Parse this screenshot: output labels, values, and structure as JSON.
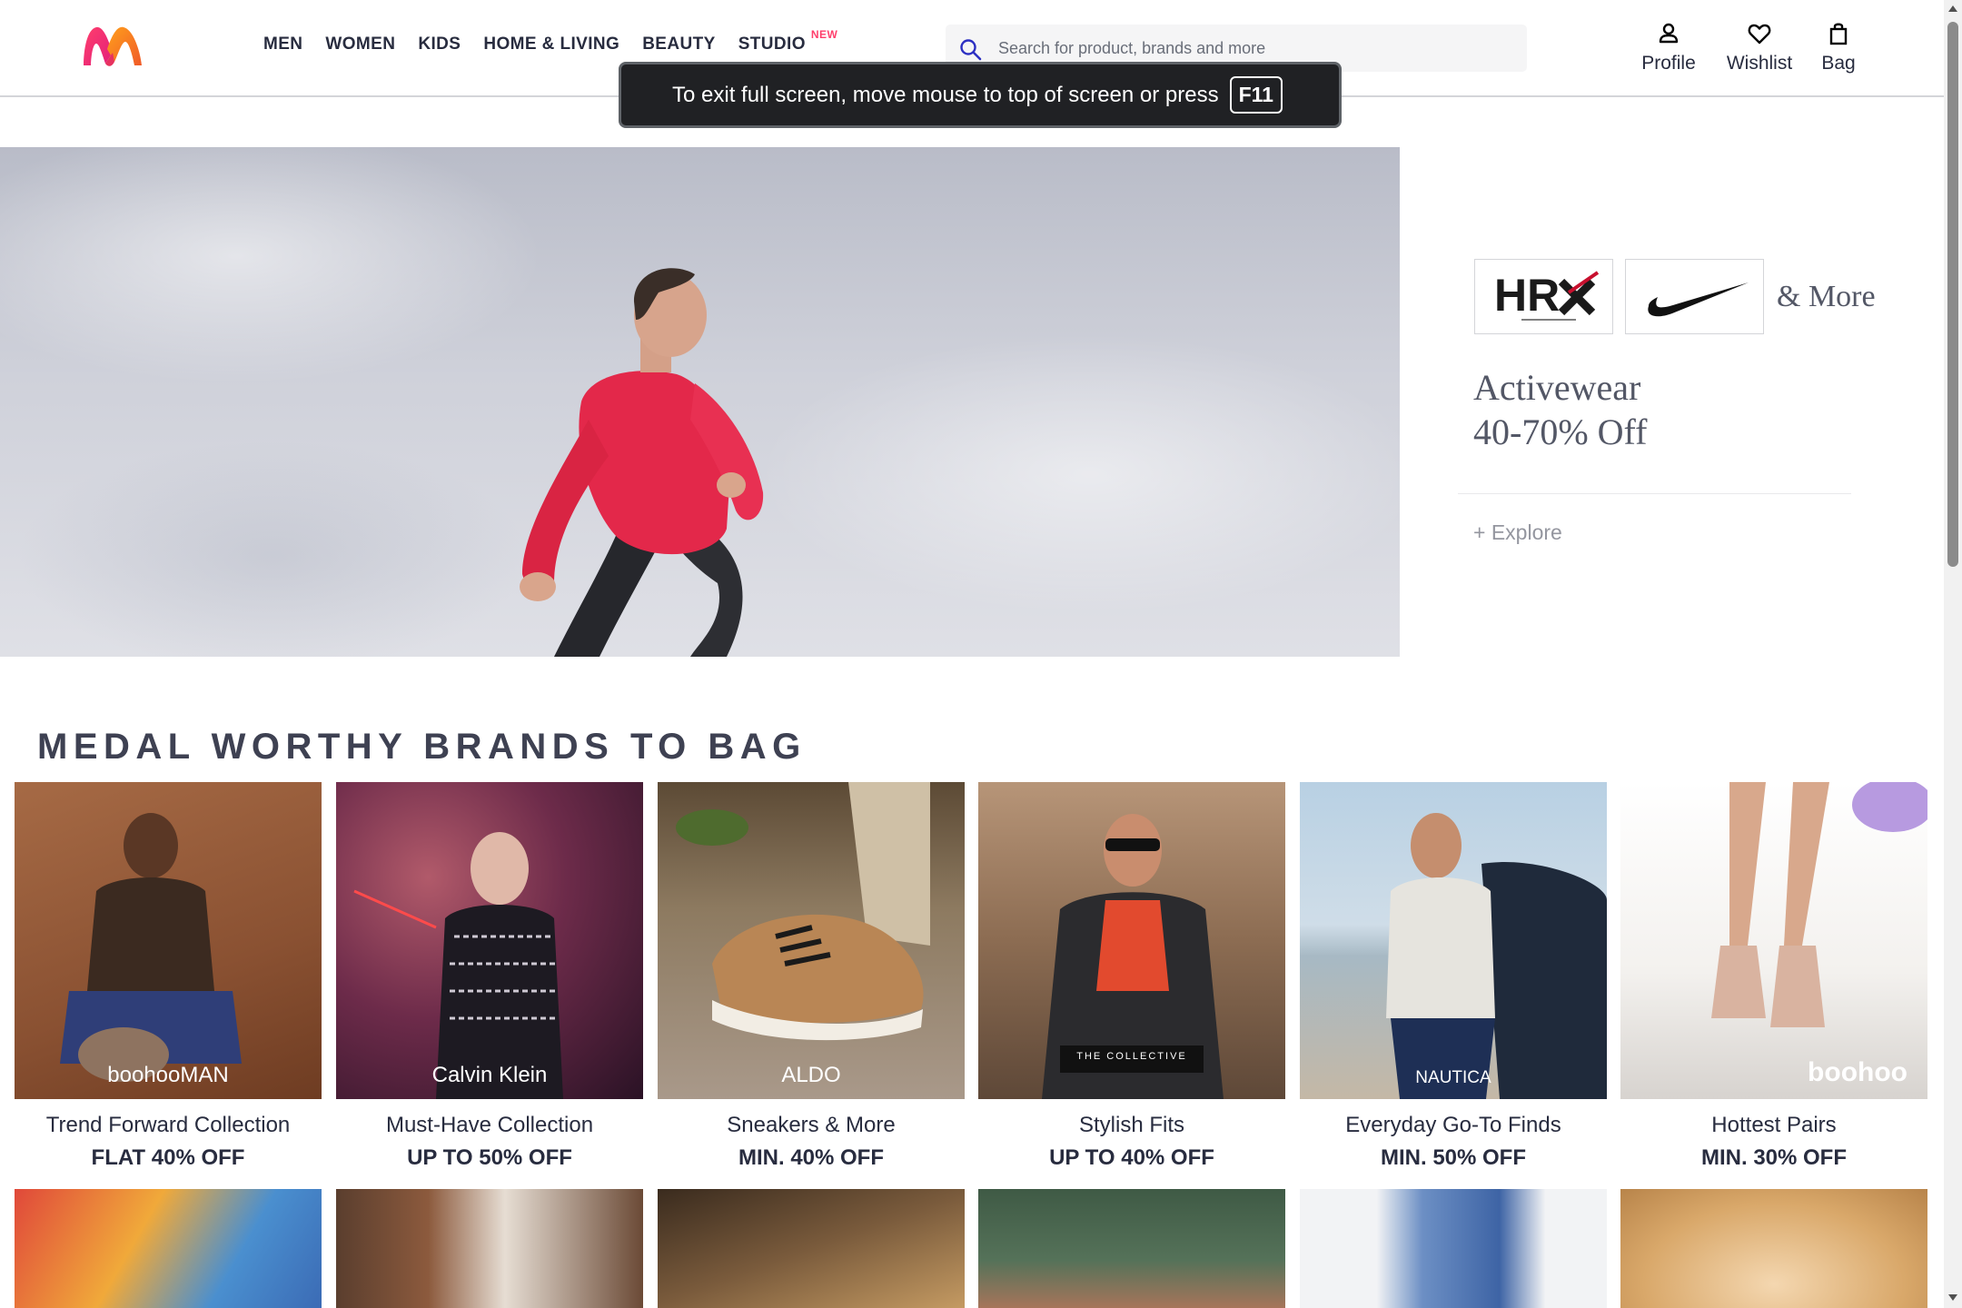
{
  "header": {
    "logo": "myntra-logo",
    "nav": [
      {
        "label": "Men"
      },
      {
        "label": "Women"
      },
      {
        "label": "Kids"
      },
      {
        "label": "Home & Living"
      },
      {
        "label": "Beauty"
      },
      {
        "label": "Studio",
        "badge": "NEW"
      }
    ],
    "search": {
      "placeholder": "Search for product, brands and more",
      "value": "",
      "icon": "search-icon"
    },
    "actions": [
      {
        "label": "Profile",
        "icon": "profile-icon"
      },
      {
        "label": "Wishlist",
        "icon": "heart-icon"
      },
      {
        "label": "Bag",
        "icon": "bag-icon"
      }
    ]
  },
  "fullscreen_toast": {
    "text": "To exit full screen, move mouse to top of screen or press",
    "key": "F11"
  },
  "hero": {
    "brands": [
      "HRX",
      "Nike"
    ],
    "more": "& More",
    "title_line1": "Activewear",
    "title_line2": "40-70% Off",
    "cta": "+ Explore"
  },
  "section": {
    "title": "Medal Worthy Brands To Bag",
    "cards": [
      {
        "brand": "boohooMAN",
        "title": "Trend Forward Collection",
        "offer": "FLAT 40% OFF"
      },
      {
        "brand": "Calvin Klein",
        "title": "Must-Have Collection",
        "offer": "UP TO 50% OFF"
      },
      {
        "brand": "ALDO",
        "title": "Sneakers & More",
        "offer": "MIN. 40% OFF"
      },
      {
        "brand": "THE COLLECTIVE",
        "title": "Stylish Fits",
        "offer": "UP TO 40% OFF"
      },
      {
        "brand": "NAUTICA",
        "title": "Everyday Go-To Finds",
        "offer": "MIN. 50% OFF"
      },
      {
        "brand": "boohoo",
        "title": "Hottest Pairs",
        "offer": "MIN. 30% OFF"
      }
    ]
  },
  "colors": {
    "accent": "#ff3f6c",
    "text": "#282c3f",
    "muted": "#94969f"
  }
}
